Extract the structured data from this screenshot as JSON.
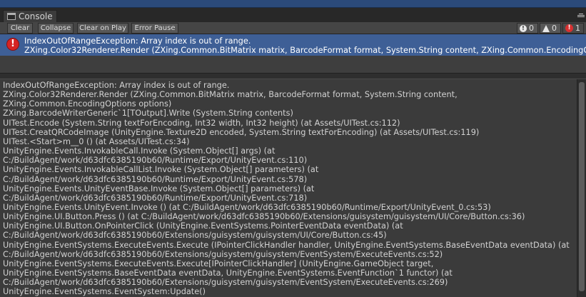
{
  "window": {
    "tab_title": "Console",
    "tab_icon": "console-icon"
  },
  "toolbar": {
    "clear_label": "Clear",
    "collapse_label": "Collapse",
    "clear_on_play_label": "Clear on Play",
    "error_pause_label": "Error Pause",
    "info_count": "0",
    "warning_count": "0",
    "error_count": "1"
  },
  "log": {
    "selected_entry": {
      "icon": "error-icon",
      "line1": "IndexOutOfRangeException: Array index is out of range.",
      "line2": "ZXing.Color32Renderer.Render (ZXing.Common.BitMatrix matrix, BarcodeFormat format, System.String content, ZXing.Common.EncodingOptions options)"
    }
  },
  "stack_trace": [
    "IndexOutOfRangeException: Array index is out of range.",
    "ZXing.Color32Renderer.Render (ZXing.Common.BitMatrix matrix, BarcodeFormat format, System.String content,",
    "ZXing.Common.EncodingOptions options)",
    "ZXing.BarcodeWriterGeneric`1[TOutput].Write (System.String contents)",
    "UITest.Encode (System.String textForEncoding, Int32 width, Int32 height) (at Assets/UITest.cs:112)",
    "UITest.CreatQRCodeImage (UnityEngine.Texture2D encoded, System.String textForEncoding) (at Assets/UITest.cs:119)",
    "UITest.<Start>m__0 () (at Assets/UITest.cs:34)",
    "UnityEngine.Events.InvokableCall.Invoke (System.Object[] args) (at",
    "C:/BuildAgent/work/d63dfc6385190b60/Runtime/Export/UnityEvent.cs:110)",
    "UnityEngine.Events.InvokableCallList.Invoke (System.Object[] parameters) (at",
    "C:/BuildAgent/work/d63dfc6385190b60/Runtime/Export/UnityEvent.cs:578)",
    "UnityEngine.Events.UnityEventBase.Invoke (System.Object[] parameters) (at",
    "C:/BuildAgent/work/d63dfc6385190b60/Runtime/Export/UnityEvent.cs:718)",
    "UnityEngine.Events.UnityEvent.Invoke () (at C:/BuildAgent/work/d63dfc6385190b60/Runtime/Export/UnityEvent_0.cs:53)",
    "UnityEngine.UI.Button.Press () (at C:/BuildAgent/work/d63dfc6385190b60/Extensions/guisystem/guisystem/UI/Core/Button.cs:36)",
    "UnityEngine.UI.Button.OnPointerClick (UnityEngine.EventSystems.PointerEventData eventData) (at",
    "C:/BuildAgent/work/d63dfc6385190b60/Extensions/guisystem/guisystem/UI/Core/Button.cs:45)",
    "UnityEngine.EventSystems.ExecuteEvents.Execute (IPointerClickHandler handler, UnityEngine.EventSystems.BaseEventData eventData) (at",
    "C:/BuildAgent/work/d63dfc6385190b60/Extensions/guisystem/guisystem/EventSystem/ExecuteEvents.cs:52)",
    "UnityEngine.EventSystems.ExecuteEvents.Execute[IPointerClickHandler] (UnityEngine.GameObject target,",
    "UnityEngine.EventSystems.BaseEventData eventData, UnityEngine.EventSystems.EventFunction`1 functor) (at",
    "C:/BuildAgent/work/d63dfc6385190b60/Extensions/guisystem/guisystem/EventSystem/ExecuteEvents.cs:269)",
    "UnityEngine.EventSystems.EventSystem:Update()"
  ],
  "colors": {
    "selected_row": "#3e5f96",
    "error_red": "#d62424",
    "panel_bg": "#3b3b3b"
  }
}
